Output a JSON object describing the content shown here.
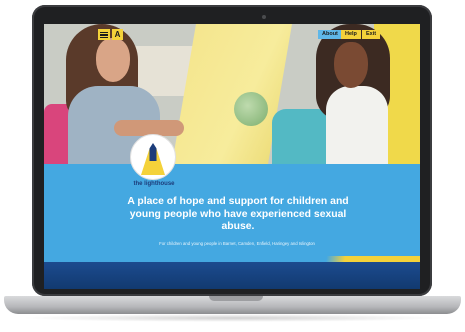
{
  "header": {
    "about_label": "About",
    "help_label": "Help",
    "exit_label": "Exit",
    "text_size_label": "A",
    "menu_icon": "hamburger-menu-icon"
  },
  "logo": {
    "name": "the lighthouse",
    "icon": "lighthouse-icon"
  },
  "hero": {
    "headline": "A place of hope and support for children and young people who have experienced sexual abuse.",
    "subline": "For children and young people in Barnet, Camden, Enfield, Haringey and Islington"
  },
  "colors": {
    "brand_blue": "#44a8e1",
    "brand_yellow": "#f4d23a",
    "brand_navy": "#1c3c7a"
  }
}
